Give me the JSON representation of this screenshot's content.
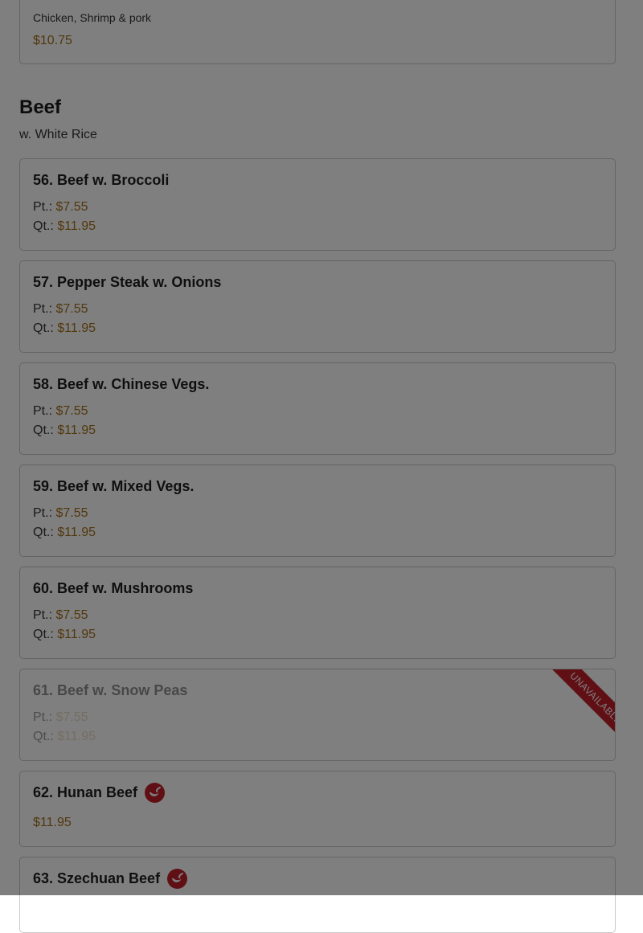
{
  "prev_item": {
    "description": "Chicken, Shrimp & pork",
    "price": "$10.75"
  },
  "section": {
    "title": "Beef",
    "subtitle": "w. White Rice"
  },
  "price_labels": {
    "pint": "Pt.:",
    "quart": "Qt.:"
  },
  "badge": {
    "unavailable": "UNAVAILABLE"
  },
  "colors": {
    "price": "#a5701b",
    "accent_red": "#c0202a",
    "overlay": "rgba(0,0,0,0.5)"
  },
  "items": [
    {
      "name": "56. Beef w. Broccoli",
      "pint_price": "$7.55",
      "quart_price": "$11.95"
    },
    {
      "name": "57. Pepper Steak w. Onions",
      "pint_price": "$7.55",
      "quart_price": "$11.95"
    },
    {
      "name": "58. Beef w. Chinese Vegs.",
      "pint_price": "$7.55",
      "quart_price": "$11.95"
    },
    {
      "name": "59. Beef w. Mixed Vegs.",
      "pint_price": "$7.55",
      "quart_price": "$11.95"
    },
    {
      "name": "60. Beef w. Mushrooms",
      "pint_price": "$7.55",
      "quart_price": "$11.95"
    },
    {
      "name": "61. Beef w. Snow Peas",
      "pint_price": "$7.55",
      "quart_price": "$11.95",
      "available": false
    },
    {
      "name": "62. Hunan Beef",
      "price": "$11.95",
      "spicy": true,
      "icon": "chili-pepper-icon"
    },
    {
      "name": "63. Szechuan Beef",
      "spicy": true,
      "icon": "chili-pepper-icon"
    }
  ]
}
